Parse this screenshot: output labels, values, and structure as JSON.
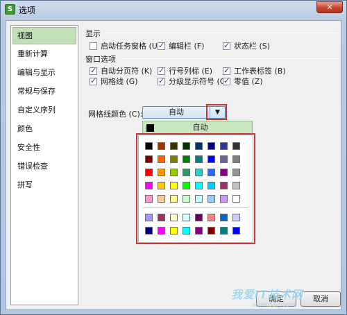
{
  "window": {
    "title": "选项",
    "app_icon": "S",
    "close_label": "✕"
  },
  "sidebar": {
    "items": [
      {
        "label": "视图",
        "active": true
      },
      {
        "label": "重新计算"
      },
      {
        "label": "编辑与显示"
      },
      {
        "label": "常规与保存"
      },
      {
        "label": "自定义序列"
      },
      {
        "label": "颜色"
      },
      {
        "label": "安全性"
      },
      {
        "label": "错误检查"
      },
      {
        "label": "拼写"
      }
    ]
  },
  "display": {
    "title": "显示",
    "options": [
      {
        "label": "启动任务窗格 (U)",
        "checked": false
      },
      {
        "label": "编辑栏 (F)",
        "checked": true
      },
      {
        "label": "状态栏 (S)",
        "checked": true
      }
    ]
  },
  "window_options": {
    "title": "窗口选项",
    "options": [
      {
        "label": "自动分页符 (K)",
        "checked": true
      },
      {
        "label": "行号列标 (E)",
        "checked": true
      },
      {
        "label": "工作表标签 (B)",
        "checked": true
      },
      {
        "label": "网格线 (G)",
        "checked": true
      },
      {
        "label": "分级显示符号 (O)",
        "checked": true
      },
      {
        "label": "零值 (Z)",
        "checked": true
      }
    ]
  },
  "grid_color": {
    "label": "网格线颜色 (C):",
    "selected": "自动",
    "dropdown_auto": "自动",
    "arrow": "▼"
  },
  "palette": {
    "main": [
      "#000000",
      "#993300",
      "#333300",
      "#003300",
      "#003366",
      "#000080",
      "#333399",
      "#333333",
      "#800000",
      "#ff6600",
      "#808000",
      "#008000",
      "#008080",
      "#0000ff",
      "#666699",
      "#808080",
      "#ff0000",
      "#ff9900",
      "#99cc00",
      "#339966",
      "#33cccc",
      "#3366ff",
      "#800080",
      "#969696",
      "#ff00ff",
      "#ffcc00",
      "#ffff00",
      "#00ff00",
      "#00ffff",
      "#00ccff",
      "#993366",
      "#c0c0c0",
      "#ff99cc",
      "#ffcc99",
      "#ffff99",
      "#ccffcc",
      "#ccffff",
      "#99ccff",
      "#cc99ff",
      "#ffffff"
    ],
    "extra": [
      "#9999ff",
      "#993366",
      "#ffffcc",
      "#ccffff",
      "#660066",
      "#ff8080",
      "#0066cc",
      "#ccccff",
      "#000080",
      "#ff00ff",
      "#ffff00",
      "#00ffff",
      "#800080",
      "#800000",
      "#008080",
      "#0000ff"
    ]
  },
  "buttons": {
    "ok": "确定",
    "cancel": "取消"
  },
  "watermark": {
    "text": "我爱IT技术网",
    "url": "www.52ij.com"
  }
}
